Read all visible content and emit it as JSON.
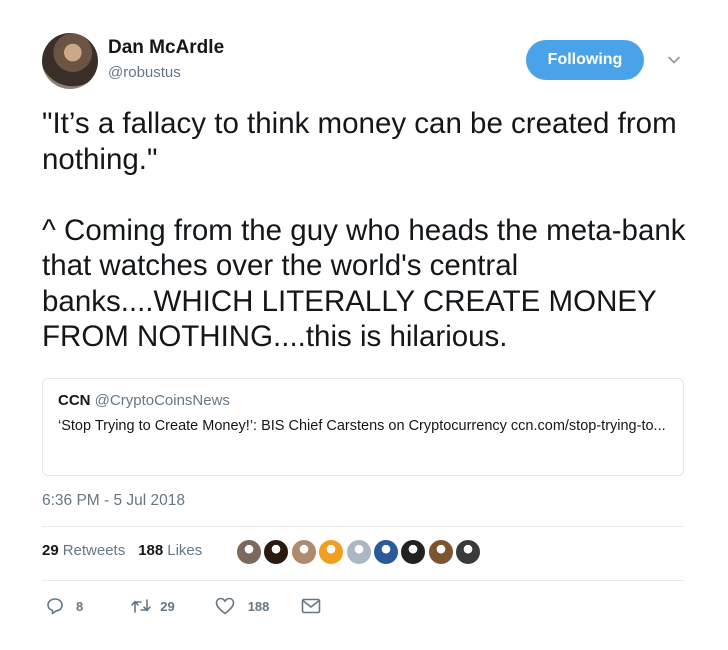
{
  "user": {
    "name": "Dan McArdle",
    "handle": "@robustus"
  },
  "follow_button": {
    "label": "Following",
    "color": "#4aa3e8"
  },
  "tweet": {
    "text": "\"It’s a fallacy to think money can be created from nothing.\"\n\n^ Coming from the guy who heads the meta-bank that watches over the world's central banks....WHICH LITERALLY CREATE MONEY FROM NOTHING....this is hilarious.",
    "timestamp": "6:36 PM - 5 Jul 2018"
  },
  "quoted_tweet": {
    "name": "CCN",
    "handle": "@CryptoCoinsNews",
    "text": "‘Stop Trying to Create Money!’: BIS Chief Carstens on Cryptocurrency ccn.com/stop-trying-to..."
  },
  "stats": {
    "retweets_count": "29",
    "retweets_label": "Retweets",
    "likes_count": "188",
    "likes_label": "Likes"
  },
  "likers": [
    {
      "icon": "avatar-photo",
      "color": "#7a6a5e"
    },
    {
      "icon": "avatar-candle",
      "color": "#2b1a0e"
    },
    {
      "icon": "avatar-photo",
      "color": "#b08a6e"
    },
    {
      "icon": "avatar-bitproj",
      "color": "#f0a020"
    },
    {
      "icon": "avatar-default",
      "color": "#aab8c2"
    },
    {
      "icon": "avatar-photo",
      "color": "#2a5a9a"
    },
    {
      "icon": "avatar-photo",
      "color": "#222222"
    },
    {
      "icon": "avatar-photo",
      "color": "#7a5530"
    },
    {
      "icon": "avatar-photo",
      "color": "#3b3b3b"
    }
  ],
  "actions": {
    "reply_count": "8",
    "retweet_count": "29",
    "like_count": "188"
  },
  "colors": {
    "text": "#14171a",
    "secondary": "#657786",
    "border": "#e1e8ed"
  }
}
